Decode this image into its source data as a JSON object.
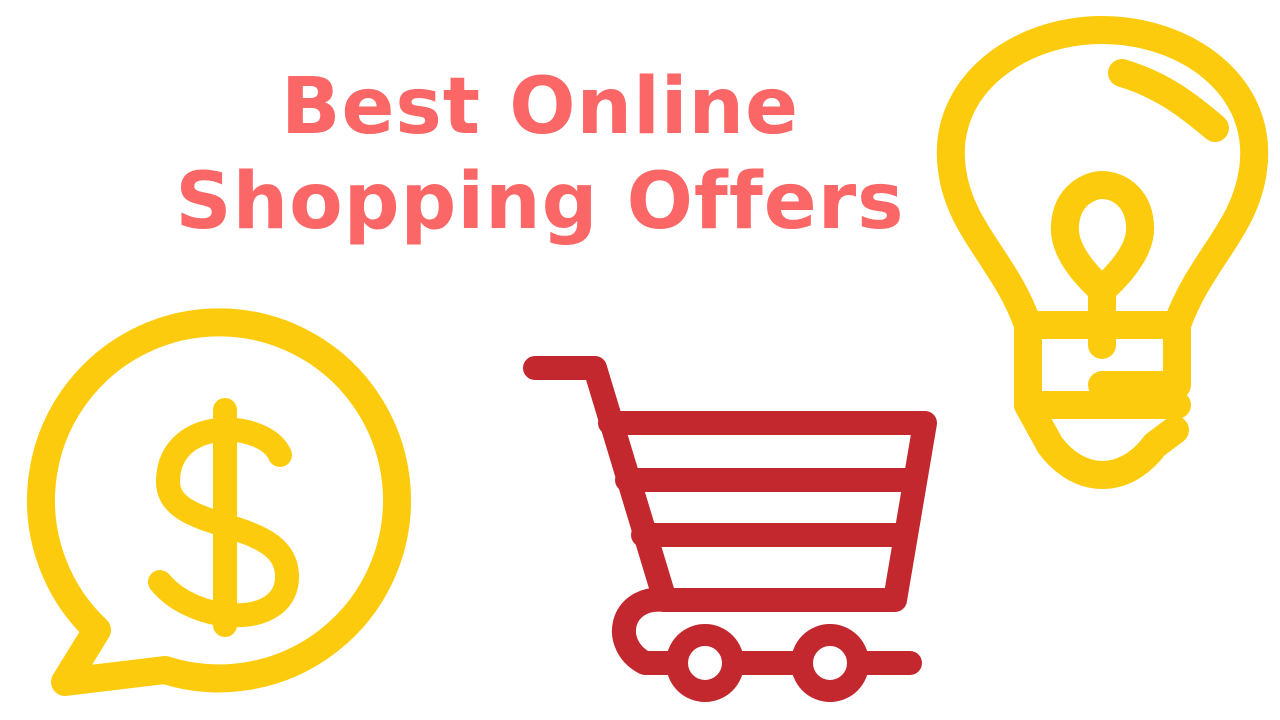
{
  "title": {
    "line1": "Best Online",
    "line2": "Shopping Offers"
  },
  "colors": {
    "title": "#fb6666",
    "accent_yellow": "#fdcb0d",
    "cart_red": "#c3282f",
    "background": "#ffffff"
  },
  "icons": {
    "money": "dollar-speech-bubble-icon",
    "cart": "shopping-cart-icon",
    "bulb": "light-bulb-icon"
  }
}
